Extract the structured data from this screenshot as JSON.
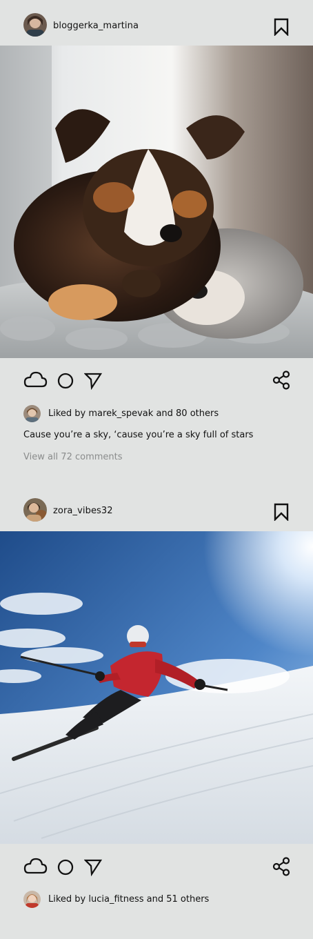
{
  "posts": [
    {
      "username": "bloggerka_martina",
      "image_alt": "Two puppies sleeping on a grey knitted blanket",
      "likes_text": "Liked by marek_spevak and 80 others",
      "caption": "Cause you’re a sky, ‘cause you’re a sky full of stars",
      "comments_link": "View all 72 comments"
    },
    {
      "username": "zora_vibes32",
      "image_alt": "Skier in red jacket carving down a snowy slope",
      "likes_text": "Liked by lucia_fitness and 51 others"
    }
  ],
  "icons": [
    "bookmark-icon",
    "cloud-icon",
    "circle-icon",
    "send-icon",
    "share-icon"
  ],
  "colors": {
    "background": "#e1e3e2",
    "text": "#111111",
    "muted": "#8a8c8c"
  }
}
